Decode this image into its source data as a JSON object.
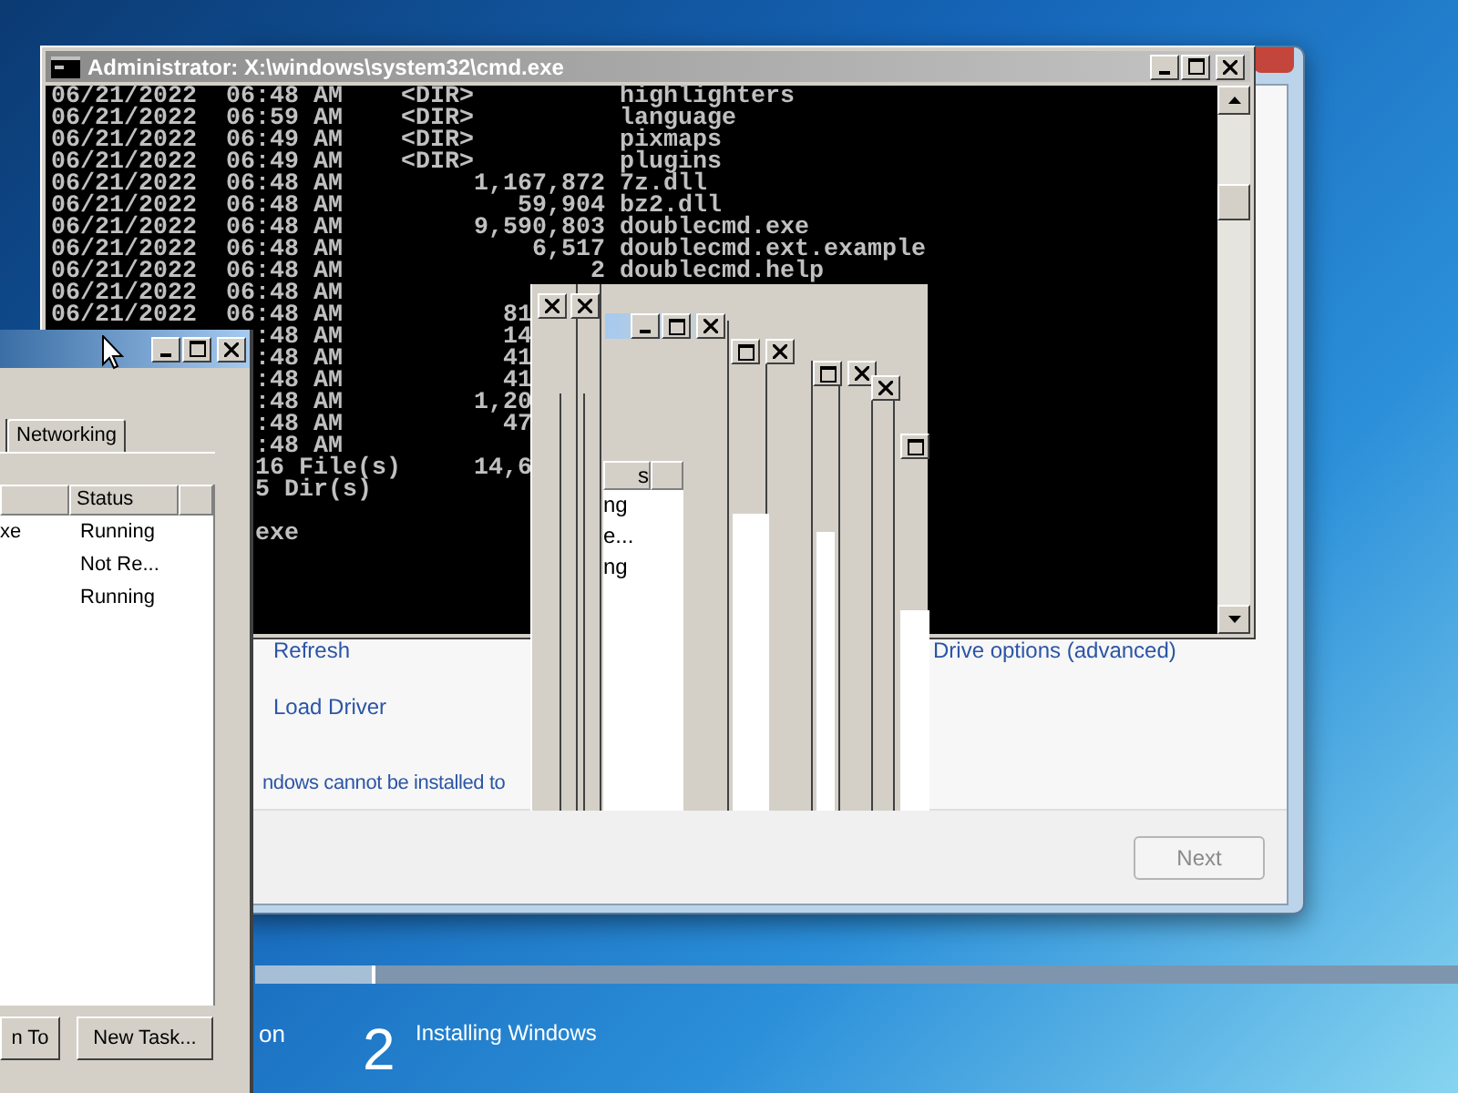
{
  "setup_window": {
    "refresh_link": "Refresh",
    "drive_options_link": "Drive options (advanced)",
    "load_driver_link": "Load Driver",
    "message": "ndows cannot be installed to",
    "next_button": {
      "label": "Next",
      "disabled": true
    }
  },
  "setup_steps": {
    "level": 0.1,
    "partial_label": "on",
    "step_number": "2",
    "step_label": "Installing Windows"
  },
  "cmd_window": {
    "title": "Administrator: X:\\windows\\system32\\cmd.exe",
    "rows": [
      {
        "kind": "entry",
        "date": "06/21/2022",
        "time": "06:48 AM",
        "dir": "<DIR>",
        "name": "highlighters"
      },
      {
        "kind": "entry",
        "date": "06/21/2022",
        "time": "06:59 AM",
        "dir": "<DIR>",
        "name": "language"
      },
      {
        "kind": "entry",
        "date": "06/21/2022",
        "time": "06:49 AM",
        "dir": "<DIR>",
        "name": "pixmaps"
      },
      {
        "kind": "entry",
        "date": "06/21/2022",
        "time": "06:49 AM",
        "dir": "<DIR>",
        "name": "plugins"
      },
      {
        "kind": "entry",
        "date": "06/21/2022",
        "time": "06:48 AM",
        "size": "1,167,872",
        "name": "7z.dll"
      },
      {
        "kind": "entry",
        "date": "06/21/2022",
        "time": "06:48 AM",
        "size": "59,904",
        "name": "bz2.dll"
      },
      {
        "kind": "entry",
        "date": "06/21/2022",
        "time": "06:48 AM",
        "size": "9,590,803",
        "name": "doublecmd.exe"
      },
      {
        "kind": "entry",
        "date": "06/21/2022",
        "time": "06:48 AM",
        "size": "6,517",
        "name": "doublecmd.ext.example"
      },
      {
        "kind": "entry",
        "date": "06/21/2022",
        "time": "06:48 AM",
        "size": "2",
        "name": "doublecmd.help"
      },
      {
        "kind": "entry",
        "date": "06/21/2022",
        "time": "06:48 AM"
      },
      {
        "kind": "entry",
        "date": "06/21/2022",
        "time": "06:48 AM",
        "size": "81"
      },
      {
        "kind": "entry",
        "time": ":48 AM",
        "size": "14"
      },
      {
        "kind": "entry",
        "time": ":48 AM",
        "size": "41"
      },
      {
        "kind": "entry",
        "time": ":48 AM",
        "size": "41"
      },
      {
        "kind": "entry",
        "time": ":48 AM",
        "size": "1,20"
      },
      {
        "kind": "entry",
        "time": ":48 AM",
        "size": "47"
      },
      {
        "kind": "entry",
        "time": ":48 AM"
      },
      {
        "kind": "summary",
        "count": "16 File(s)",
        "bytes": "14,6"
      },
      {
        "kind": "summary",
        "count": "5 Dir(s)"
      },
      {
        "kind": "blank"
      },
      {
        "kind": "prompt",
        "text": "exe"
      }
    ]
  },
  "task_manager": {
    "tabs": [
      {
        "label": "Networking",
        "selected": false
      }
    ],
    "columns": [
      {
        "label": "Status"
      }
    ],
    "rows": [
      {
        "column_1": "xe",
        "status": "Running"
      },
      {
        "status": "Not Re..."
      },
      {
        "status": "Running"
      }
    ],
    "buttons": [
      "n To",
      "New Task..."
    ]
  },
  "ghost_windows": {
    "header": "s",
    "rows": [
      "ng",
      "e...",
      "ng"
    ]
  }
}
